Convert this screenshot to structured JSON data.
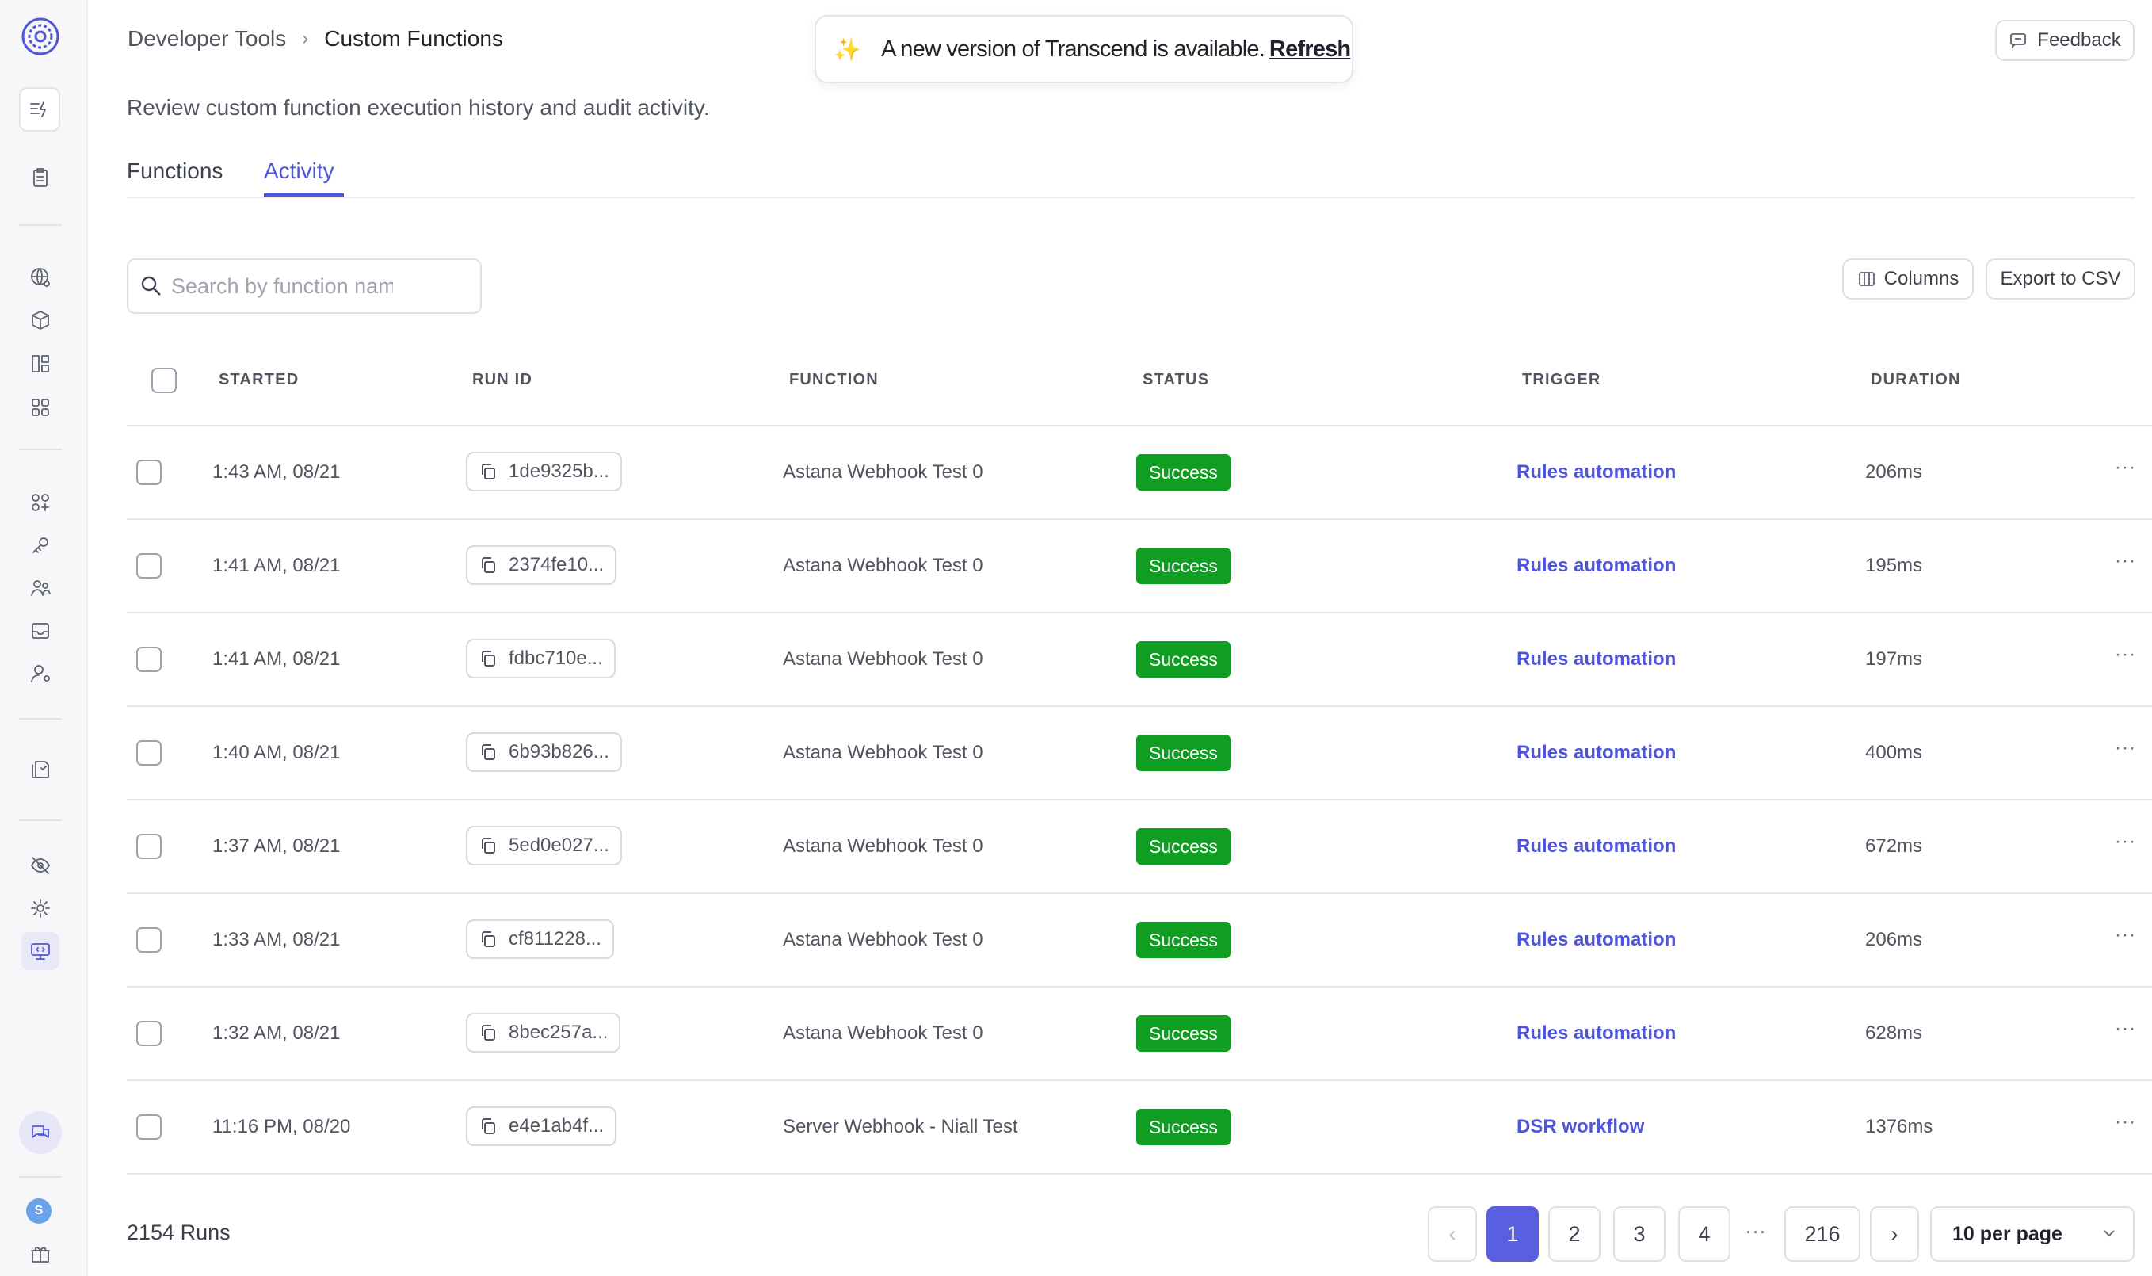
{
  "breadcrumb": {
    "parent": "Developer Tools",
    "separator": "›",
    "current": "Custom Functions"
  },
  "subtitle": "Review custom function execution history and audit activity.",
  "toast": {
    "message": "A new version of Transcend is available.",
    "action": "Refresh"
  },
  "feedback_label": "Feedback",
  "tabs": [
    {
      "label": "Functions"
    },
    {
      "label": "Activity"
    }
  ],
  "search": {
    "placeholder": "Search by function name"
  },
  "toolbar": {
    "columns_label": "Columns",
    "export_label": "Export to CSV"
  },
  "table": {
    "headers": {
      "started": "STARTED",
      "run_id": "RUN ID",
      "function": "FUNCTION",
      "status": "STATUS",
      "trigger": "TRIGGER",
      "duration": "DURATION"
    },
    "rows": [
      {
        "started": "1:43 AM, 08/21",
        "run_id": "1de9325b...",
        "function": "Astana Webhook Test 0",
        "status": "Success",
        "trigger": "Rules automation",
        "duration": "206ms"
      },
      {
        "started": "1:41 AM, 08/21",
        "run_id": "2374fe10...",
        "function": "Astana Webhook Test 0",
        "status": "Success",
        "trigger": "Rules automation",
        "duration": "195ms"
      },
      {
        "started": "1:41 AM, 08/21",
        "run_id": "fdbc710e...",
        "function": "Astana Webhook Test 0",
        "status": "Success",
        "trigger": "Rules automation",
        "duration": "197ms"
      },
      {
        "started": "1:40 AM, 08/21",
        "run_id": "6b93b826...",
        "function": "Astana Webhook Test 0",
        "status": "Success",
        "trigger": "Rules automation",
        "duration": "400ms"
      },
      {
        "started": "1:37 AM, 08/21",
        "run_id": "5ed0e027...",
        "function": "Astana Webhook Test 0",
        "status": "Success",
        "trigger": "Rules automation",
        "duration": "672ms"
      },
      {
        "started": "1:33 AM, 08/21",
        "run_id": "cf811228...",
        "function": "Astana Webhook Test 0",
        "status": "Success",
        "trigger": "Rules automation",
        "duration": "206ms"
      },
      {
        "started": "1:32 AM, 08/21",
        "run_id": "8bec257a...",
        "function": "Astana Webhook Test 0",
        "status": "Success",
        "trigger": "Rules automation",
        "duration": "628ms"
      },
      {
        "started": "11:16 PM, 08/20",
        "run_id": "e4e1ab4f...",
        "function": "Server Webhook - Niall Test",
        "status": "Success",
        "trigger": "DSR workflow",
        "duration": "1376ms"
      }
    ],
    "row_menu": "···"
  },
  "footer": {
    "runs_count": "2154 Runs",
    "pages": [
      "1",
      "2",
      "3",
      "4"
    ],
    "ellipsis": "···",
    "last_page": "216",
    "prev": "‹",
    "next": "›",
    "per_page": "10 per page"
  },
  "sidebar": {
    "avatar_initial": "S"
  },
  "colors": {
    "accent": "#4f56d9",
    "success": "#0f9d22",
    "page_active": "#5a5fe0"
  }
}
